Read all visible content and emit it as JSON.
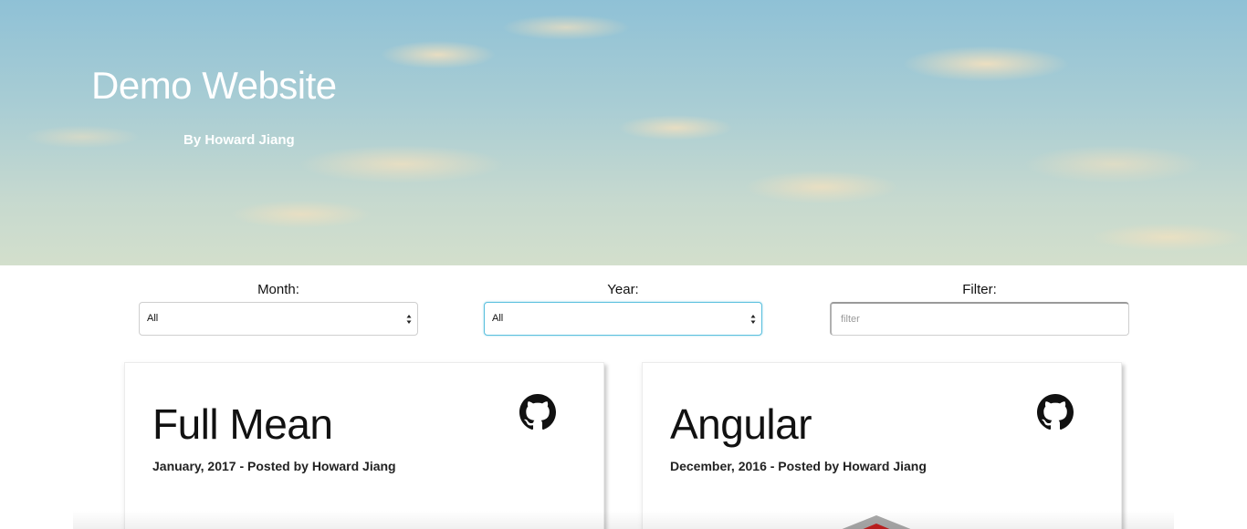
{
  "hero": {
    "title": "Demo Website",
    "subtitle": "By Howard Jiang"
  },
  "filters": {
    "month": {
      "label": "Month:",
      "selected": "All"
    },
    "year": {
      "label": "Year:",
      "selected": "All"
    },
    "text": {
      "label": "Filter:",
      "placeholder": "filter",
      "value": ""
    }
  },
  "cards": [
    {
      "title": "Full Mean",
      "meta": "January, 2017 - Posted by Howard Jiang",
      "icon": "github-icon"
    },
    {
      "title": "Angular",
      "meta": "December, 2016 - Posted by Howard Jiang",
      "icon": "github-icon"
    }
  ],
  "colors": {
    "focus_border": "#5bc0de",
    "angular_red": "#c21f1f"
  }
}
